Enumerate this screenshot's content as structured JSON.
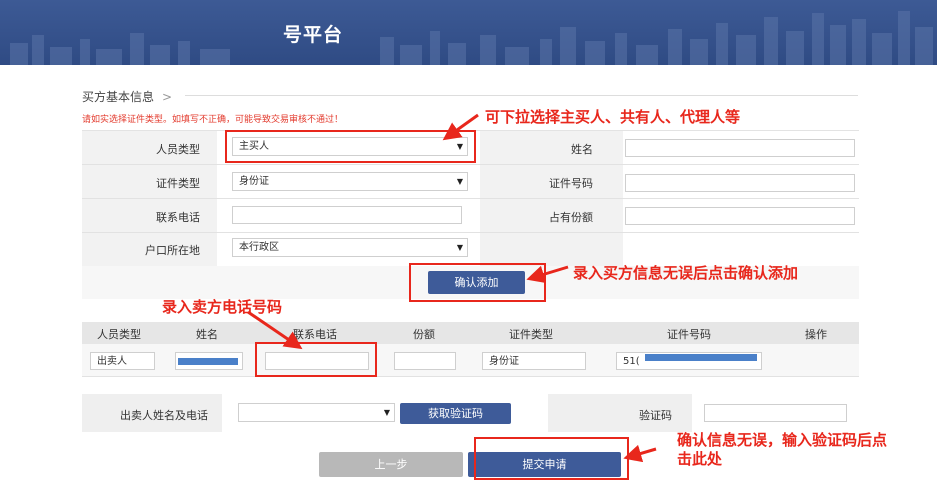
{
  "banner": {
    "title": "号平台"
  },
  "section": {
    "title": "买方基本信息",
    "chevron": ">",
    "warning": "请如实选择证件类型。如填写不正确，可能导致交易审核不通过！"
  },
  "form": {
    "person_type_label": "人员类型",
    "person_type_value": "主买人",
    "id_type_label": "证件类型",
    "id_type_value": "身份证",
    "phone_label": "联系电话",
    "phone_value": "",
    "hukou_label": "户口所在地",
    "hukou_value": "本行政区",
    "name_label": "姓名",
    "name_value": "",
    "id_no_label": "证件号码",
    "id_no_value": "",
    "share_label": "占有份额",
    "share_value": "",
    "confirm_add": "确认添加"
  },
  "seller_table": {
    "columns": [
      "人员类型",
      "姓名",
      "联系电话",
      "份额",
      "证件类型",
      "证件号码",
      "操作"
    ],
    "row": {
      "person_type": "出卖人",
      "phone": "",
      "share": "",
      "id_type": "身份证",
      "id_no_prefix": "51("
    }
  },
  "verify": {
    "seller_label": "出卖人姓名及电话",
    "seller_select_value": "",
    "get_code": "获取验证码",
    "code_label": "验证码",
    "code_value": ""
  },
  "actions": {
    "prev": "上一步",
    "submit": "提交申请"
  },
  "annotations": {
    "dropdown_hint": "可下拉选择主买人、共有人、代理人等",
    "confirm_hint": "录入买方信息无误后点击确认添加",
    "seller_phone_hint": "录入卖方电话号码",
    "submit_hint_line1": "确认信息无误，输入验证码后点",
    "submit_hint_line2": "击此处"
  },
  "icons": {
    "dropdown": "caret-down-icon",
    "section": "chevron-right-icon",
    "arrow": "red-arrow-icon"
  },
  "colors": {
    "banner": "#2f4b84",
    "primary_button": "#3e5b99",
    "secondary_button": "#b8b8b8",
    "annotation": "#e8271c",
    "masked_data": "#4a80c9"
  }
}
